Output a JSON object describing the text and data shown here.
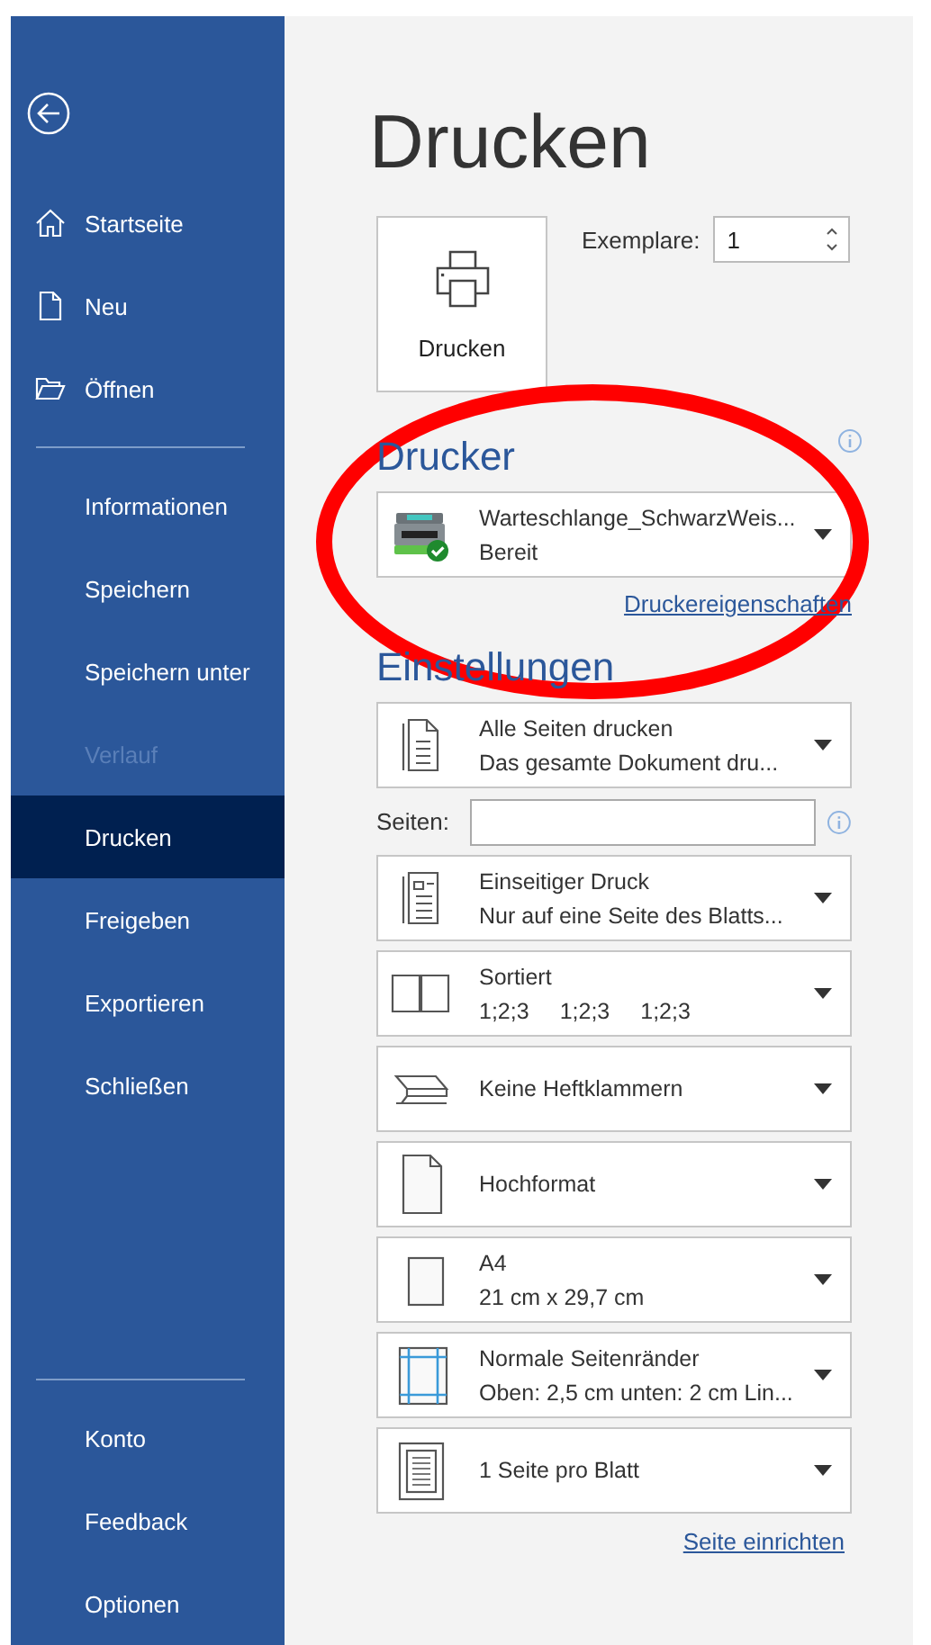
{
  "sidebar": {
    "top_items": [
      {
        "label": "Startseite",
        "kind": "home",
        "selected": false,
        "disabled": false
      },
      {
        "label": "Neu",
        "kind": "new",
        "selected": false,
        "disabled": false
      },
      {
        "label": "Öffnen",
        "kind": "open",
        "selected": false,
        "disabled": false
      }
    ],
    "items": [
      {
        "label": "Informationen",
        "selected": false,
        "disabled": false
      },
      {
        "label": "Speichern",
        "selected": false,
        "disabled": false
      },
      {
        "label": "Speichern unter",
        "selected": false,
        "disabled": false
      },
      {
        "label": "Verlauf",
        "selected": false,
        "disabled": true
      },
      {
        "label": "Drucken",
        "selected": true,
        "disabled": false
      },
      {
        "label": "Freigeben",
        "selected": false,
        "disabled": false
      },
      {
        "label": "Exportieren",
        "selected": false,
        "disabled": false
      },
      {
        "label": "Schließen",
        "selected": false,
        "disabled": false
      }
    ],
    "bottom_items": [
      {
        "label": "Konto",
        "selected": false,
        "disabled": false
      },
      {
        "label": "Feedback",
        "selected": false,
        "disabled": false
      },
      {
        "label": "Optionen",
        "selected": false,
        "disabled": false
      }
    ]
  },
  "title": "Drucken",
  "print_button": {
    "label": "Drucken"
  },
  "copies": {
    "label": "Exemplare:",
    "value": "1"
  },
  "printer": {
    "heading": "Drucker",
    "name": "Warteschlange_SchwarzWeis...",
    "status": "Bereit",
    "link": "Druckereigenschaften"
  },
  "settings": {
    "heading": "Einstellungen",
    "pages_label": "Seiten:",
    "options": [
      {
        "kind": "pages",
        "title": "Alle Seiten drucken",
        "subtitle": "Das gesamte Dokument dru..."
      },
      {
        "kind": "pages-field"
      },
      {
        "kind": "one-sided",
        "title": "Einseitiger Druck",
        "subtitle": "Nur auf eine Seite des Blatts..."
      },
      {
        "kind": "collated",
        "title": "Sortiert",
        "subtitle_parts": [
          "1;2;3",
          "1;2;3",
          "1;2;3"
        ]
      },
      {
        "kind": "staple",
        "title": "Keine Heftklammern"
      },
      {
        "kind": "portrait",
        "title": "Hochformat"
      },
      {
        "kind": "paper",
        "title": "A4",
        "subtitle": "21 cm x 29,7 cm"
      },
      {
        "kind": "margins",
        "title": "Normale Seitenränder",
        "subtitle": "Oben: 2,5 cm unten: 2 cm Lin..."
      },
      {
        "kind": "per-sheet",
        "title": "1 Seite pro Blatt"
      }
    ],
    "link": "Seite einrichten"
  }
}
